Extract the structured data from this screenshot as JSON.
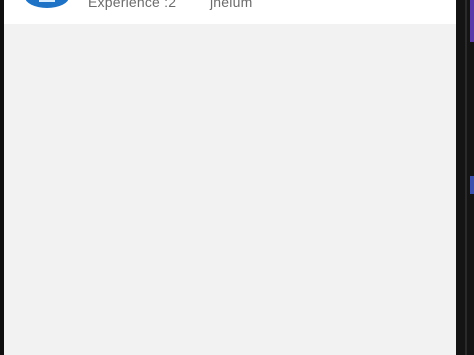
{
  "list": {
    "items": [
      {
        "experience": "Experience :2",
        "location": "jhelum",
        "avatar_icon": "company-logo-icon",
        "avatar_color": "#1e73c6"
      }
    ]
  },
  "colors": {
    "screen_background": "#f2f2f2",
    "card_background": "#ffffff",
    "text_secondary": "#6b6b6b",
    "device_frame": "#0f0f0f"
  }
}
